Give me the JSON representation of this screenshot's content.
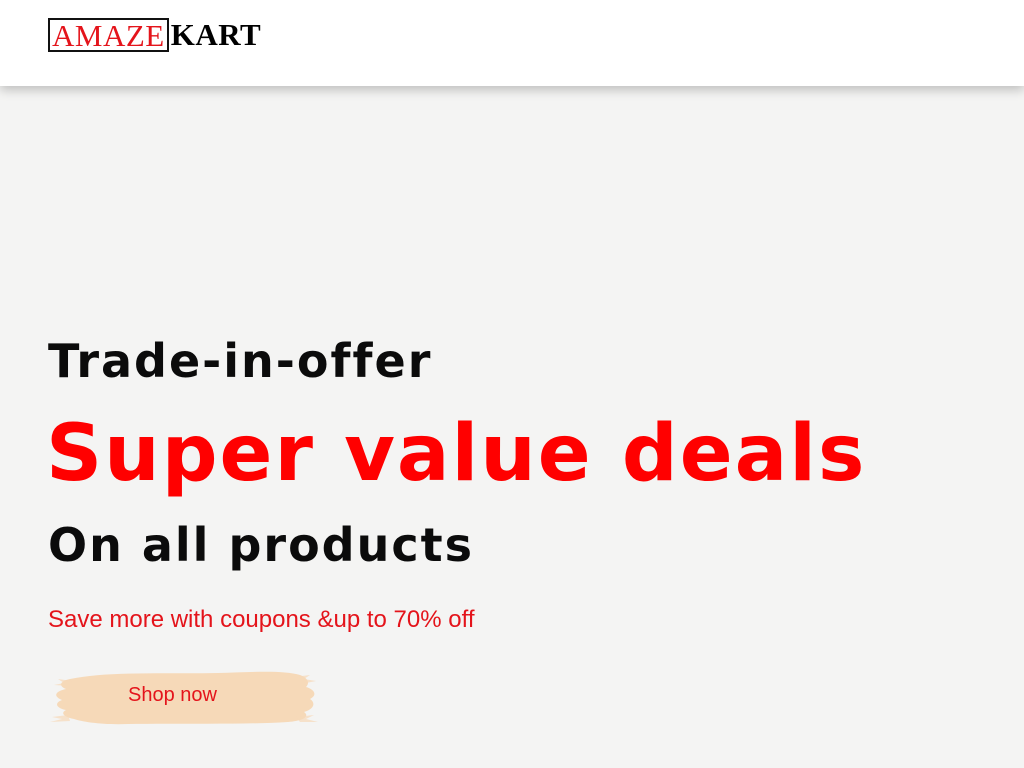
{
  "header": {
    "logo": {
      "boxed_text": "AMAZE",
      "plain_text": "KART"
    }
  },
  "hero": {
    "subtitle": "Trade-in-offer",
    "title": "Super value deals",
    "tagline": "On all products",
    "note": "Save more with coupons &up to 70% off",
    "cta": {
      "label": "Shop now",
      "background_style": "brush-stroke"
    }
  },
  "colors": {
    "accent": "#ff0000",
    "brand_red": "#e4141b",
    "text": "#0b0b0b",
    "hero_background": "#f4f4f3",
    "header_background": "#ffffff",
    "button_brush": "#f6d9b8"
  }
}
